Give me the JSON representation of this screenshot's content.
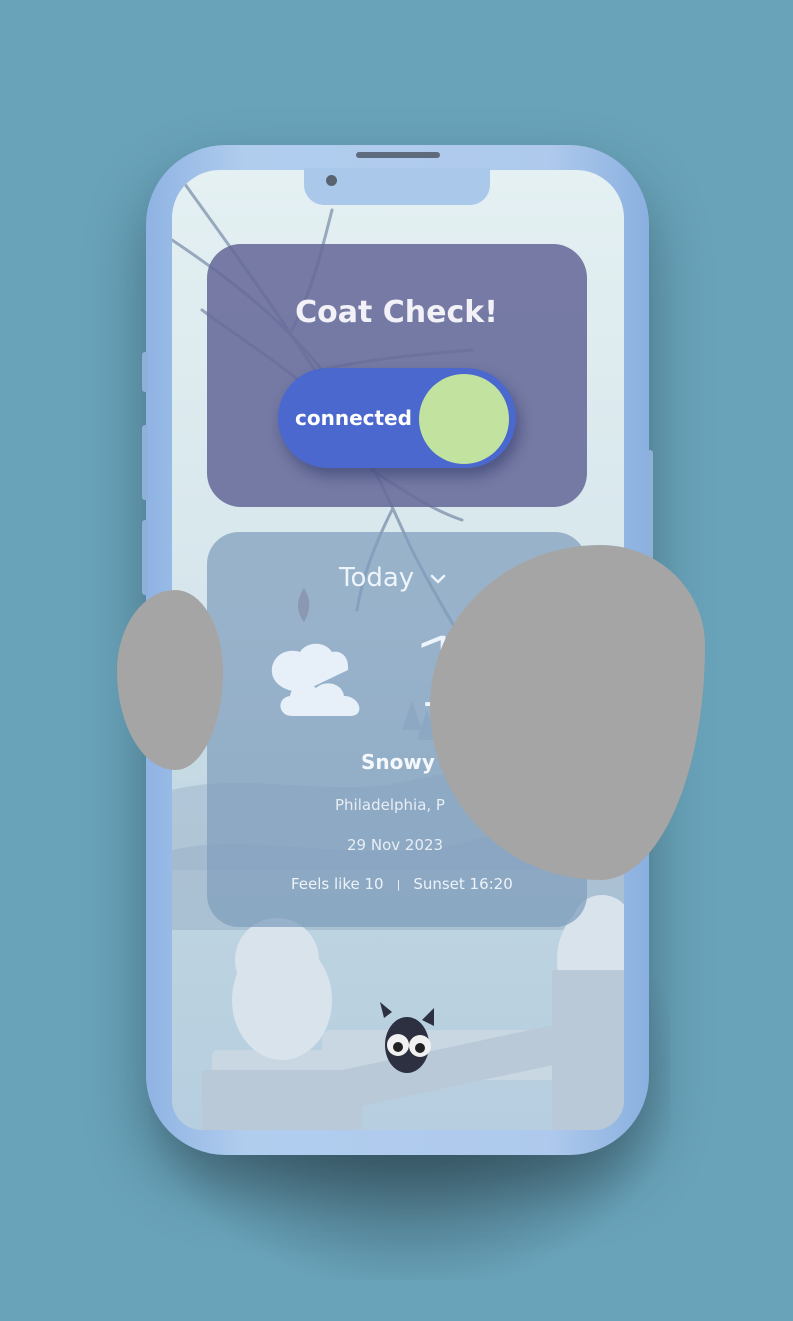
{
  "coat_check": {
    "title": "Coat Check!",
    "toggle_label": "connected",
    "toggle_on": true
  },
  "weather": {
    "period": "Today",
    "temperature": "17",
    "condition": "Snowy",
    "location": "Philadelphia, P",
    "date": "29 Nov 2023",
    "feels_like": "Feels like 10",
    "separator": "|",
    "sunset": "Sunset 16:20",
    "icon": "cloud-icon"
  },
  "colors": {
    "background": "#69a3ba",
    "toggle_track": "#4b68cf",
    "toggle_knob": "#c2e3a0",
    "coat_card": "#666a9a",
    "weather_card": "#809ebc"
  }
}
